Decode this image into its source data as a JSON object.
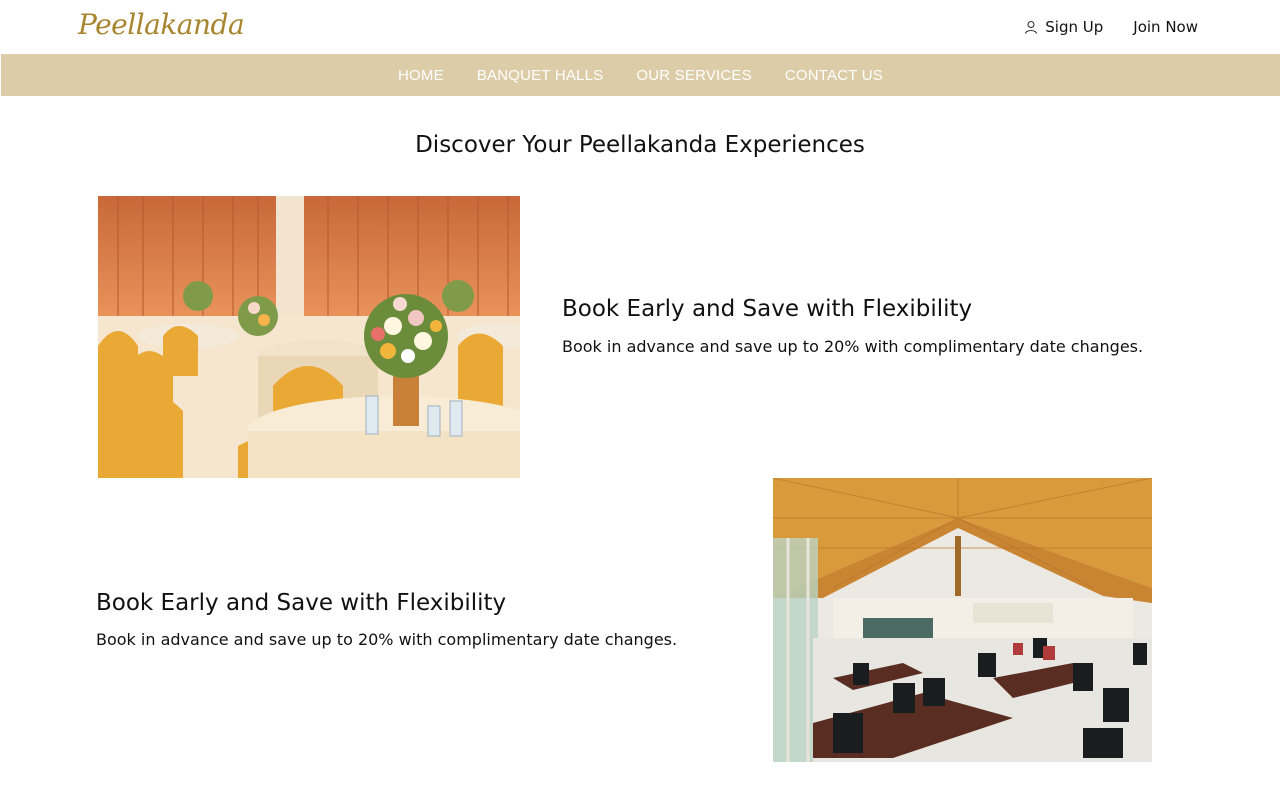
{
  "header": {
    "logo": "Peellakanda",
    "sign_up": "Sign Up",
    "join_now": "Join Now",
    "user_icon": "user-icon"
  },
  "nav": {
    "items": [
      "HOME",
      "BANQUET HALLS",
      "OUR SERVICES",
      "CONTACT US"
    ]
  },
  "main": {
    "title": "Discover Your Peellakanda Experiences",
    "features": [
      {
        "title": "Book Early and Save with Flexibility",
        "text": "Book in advance and save up to 20% with complimentary date changes."
      },
      {
        "title": "Book Early and Save with Flexibility",
        "text": "Book in advance and save up to 20% with complimentary date changes."
      }
    ]
  },
  "colors": {
    "logo": "#a8862f",
    "nav_bg": "#dccda8",
    "nav_text": "#ffffff"
  }
}
